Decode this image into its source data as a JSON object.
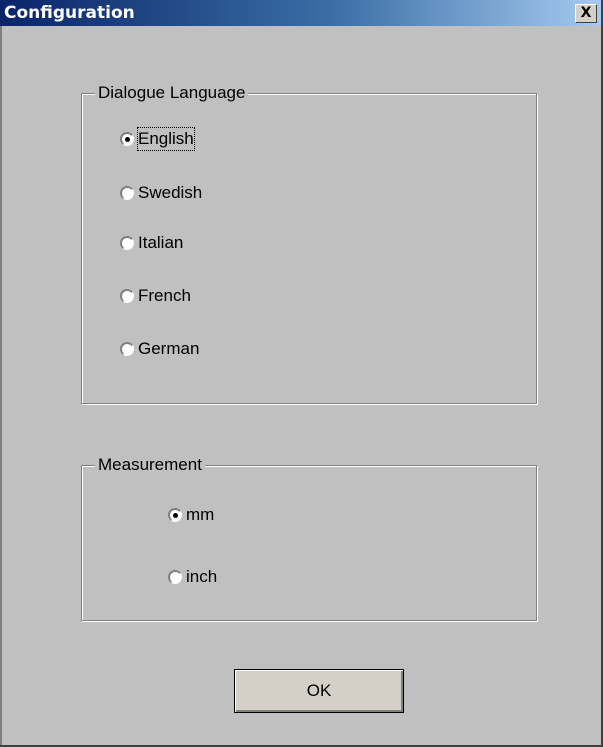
{
  "window": {
    "title": "Configuration",
    "close_label": "X"
  },
  "language_group": {
    "legend": "Dialogue Language",
    "options": [
      {
        "label": "English",
        "checked": true
      },
      {
        "label": "Swedish",
        "checked": false
      },
      {
        "label": "Italian",
        "checked": false
      },
      {
        "label": "French",
        "checked": false
      },
      {
        "label": "German",
        "checked": false
      }
    ]
  },
  "measurement_group": {
    "legend": "Measurement",
    "options": [
      {
        "label": "mm",
        "checked": true
      },
      {
        "label": "inch",
        "checked": false
      }
    ]
  },
  "ok_button": {
    "label": "OK"
  },
  "colors": {
    "face": "#c0c0c0",
    "title_start": "#0a246a",
    "title_end": "#a6caf0"
  }
}
